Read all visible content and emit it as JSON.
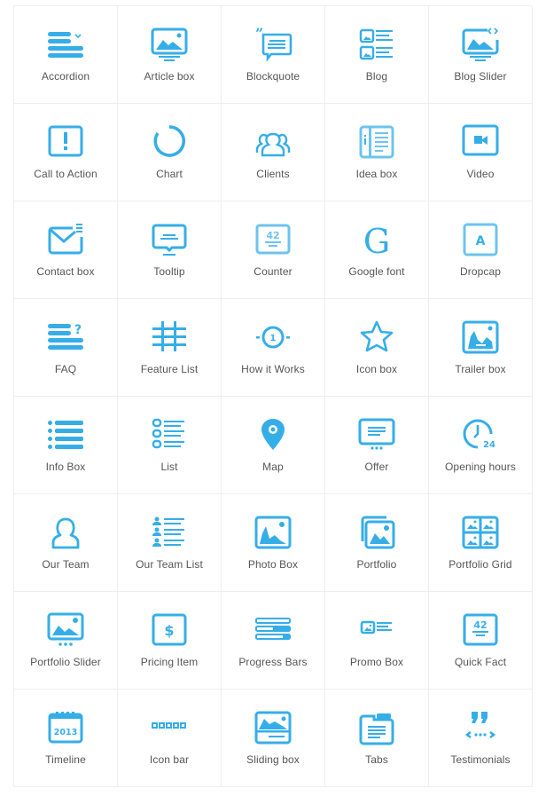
{
  "theme": {
    "icon_color": "#35aee8",
    "icon_color_light": "#6cc4ee",
    "label_color": "#555555",
    "border_color": "#eeeeee"
  },
  "items": [
    {
      "label": "Accordion",
      "icon": "accordion-icon"
    },
    {
      "label": "Article box",
      "icon": "article-box-icon"
    },
    {
      "label": "Blockquote",
      "icon": "blockquote-icon"
    },
    {
      "label": "Blog",
      "icon": "blog-icon"
    },
    {
      "label": "Blog Slider",
      "icon": "blog-slider-icon"
    },
    {
      "label": "Call to Action",
      "icon": "call-to-action-icon"
    },
    {
      "label": "Chart",
      "icon": "chart-icon"
    },
    {
      "label": "Clients",
      "icon": "clients-icon"
    },
    {
      "label": "Idea box",
      "icon": "idea-box-icon"
    },
    {
      "label": "Video",
      "icon": "video-icon"
    },
    {
      "label": "Contact box",
      "icon": "contact-box-icon"
    },
    {
      "label": "Tooltip",
      "icon": "tooltip-icon"
    },
    {
      "label": "Counter",
      "icon": "counter-icon",
      "icon_text": "42"
    },
    {
      "label": "Google font",
      "icon": "google-font-icon",
      "icon_text": "G"
    },
    {
      "label": "Dropcap",
      "icon": "dropcap-icon",
      "icon_text": "A"
    },
    {
      "label": "FAQ",
      "icon": "faq-icon",
      "icon_text": "?"
    },
    {
      "label": "Feature List",
      "icon": "feature-list-icon"
    },
    {
      "label": "How it Works",
      "icon": "how-it-works-icon",
      "icon_text": "1"
    },
    {
      "label": "Icon box",
      "icon": "icon-box-icon"
    },
    {
      "label": "Trailer box",
      "icon": "trailer-box-icon"
    },
    {
      "label": "Info Box",
      "icon": "info-box-icon"
    },
    {
      "label": "List",
      "icon": "list-icon"
    },
    {
      "label": "Map",
      "icon": "map-icon"
    },
    {
      "label": "Offer",
      "icon": "offer-icon"
    },
    {
      "label": "Opening hours",
      "icon": "opening-hours-icon",
      "icon_text": "24"
    },
    {
      "label": "Our Team",
      "icon": "our-team-icon"
    },
    {
      "label": "Our Team List",
      "icon": "our-team-list-icon"
    },
    {
      "label": "Photo Box",
      "icon": "photo-box-icon"
    },
    {
      "label": "Portfolio",
      "icon": "portfolio-icon"
    },
    {
      "label": "Portfolio Grid",
      "icon": "portfolio-grid-icon"
    },
    {
      "label": "Portfolio Slider",
      "icon": "portfolio-slider-icon"
    },
    {
      "label": "Pricing Item",
      "icon": "pricing-item-icon",
      "icon_text": "$"
    },
    {
      "label": "Progress Bars",
      "icon": "progress-bars-icon"
    },
    {
      "label": "Promo Box",
      "icon": "promo-box-icon"
    },
    {
      "label": "Quick Fact",
      "icon": "quick-fact-icon",
      "icon_text": "42"
    },
    {
      "label": "Timeline",
      "icon": "timeline-icon",
      "icon_text": "2013"
    },
    {
      "label": "Icon bar",
      "icon": "icon-bar-icon"
    },
    {
      "label": "Sliding box",
      "icon": "sliding-box-icon"
    },
    {
      "label": "Tabs",
      "icon": "tabs-icon"
    },
    {
      "label": "Testimonials",
      "icon": "testimonials-icon"
    }
  ]
}
